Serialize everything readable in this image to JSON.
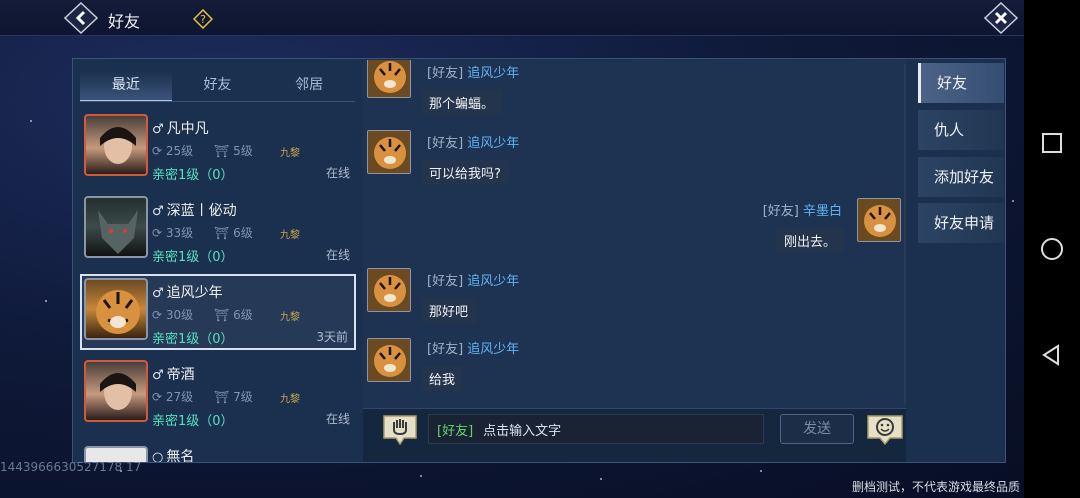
{
  "header": {
    "title": "好友"
  },
  "tabs": [
    {
      "label": "最近"
    },
    {
      "label": "好友"
    },
    {
      "label": "邻居"
    }
  ],
  "friends": [
    {
      "name": "凡中凡",
      "level": "25级",
      "level2": "5级",
      "map": "九黎",
      "intimacy": "亲密1级（0）",
      "status": "在线"
    },
    {
      "name": "深蓝丨佖动",
      "level": "33级",
      "level2": "6级",
      "map": "九黎",
      "intimacy": "亲密1级（0）",
      "status": "在线"
    },
    {
      "name": "追风少年",
      "level": "30级",
      "level2": "6级",
      "map": "九黎",
      "intimacy": "亲密1级（0）",
      "status": "3天前"
    },
    {
      "name": "帝酒",
      "level": "27级",
      "level2": "7级",
      "map": "九黎",
      "intimacy": "亲密1级（0）",
      "status": "在线"
    },
    {
      "name": "無名"
    }
  ],
  "messages": [
    {
      "channel": "[好友]",
      "sender": "追风少年",
      "text": "那个蝙蝠。"
    },
    {
      "channel": "[好友]",
      "sender": "追风少年",
      "text": "可以给我吗?"
    },
    {
      "channel": "[好友]",
      "sender": "辛墨白",
      "text": "刚出去。"
    },
    {
      "channel": "[好友]",
      "sender": "追风少年",
      "text": "那好吧"
    },
    {
      "channel": "[好友]",
      "sender": "追风少年",
      "text": "给我"
    }
  ],
  "input": {
    "channel": "[好友]",
    "placeholder": "点击输入文字",
    "send_label": "发送"
  },
  "side_tabs": [
    {
      "label": "好友"
    },
    {
      "label": "仇人"
    },
    {
      "label": "添加好友"
    },
    {
      "label": "好友申请"
    }
  ],
  "watermark": "1443966630527178 17",
  "footer": "删档测试，不代表游戏最终品质",
  "icons": [
    "back-icon",
    "help-icon",
    "close-icon",
    "voice-icon",
    "emoji-icon",
    "square-nav-icon",
    "circle-nav-icon",
    "triangle-nav-icon"
  ]
}
